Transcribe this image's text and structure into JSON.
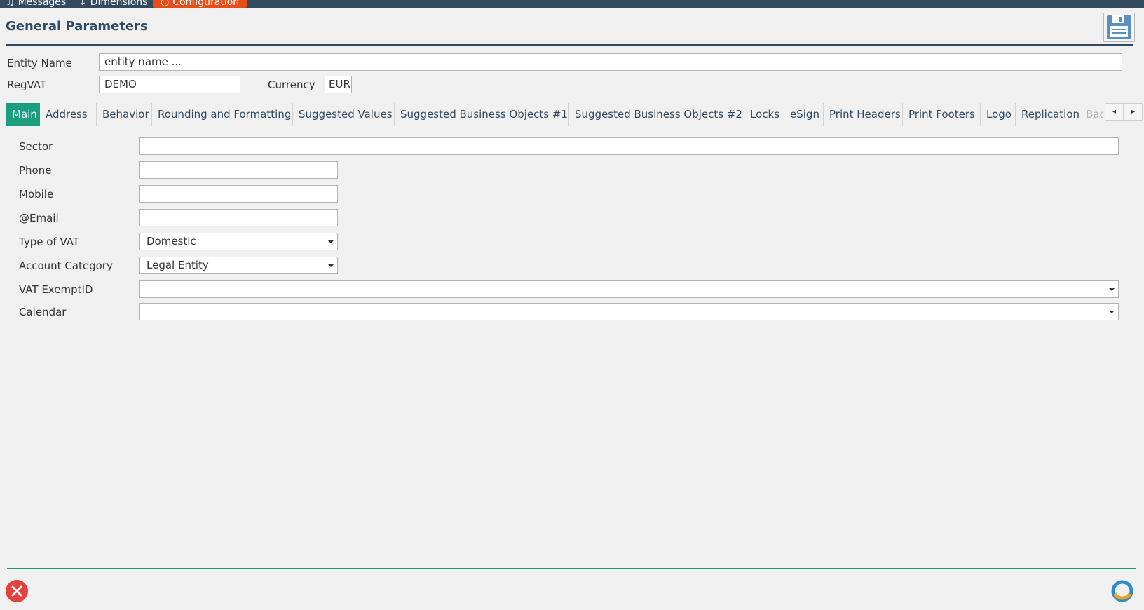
{
  "topbar": {
    "items": [
      {
        "icon": "music-note-icon",
        "glyph": "♫",
        "label": "Messages"
      },
      {
        "icon": "dimensions-icon",
        "glyph": "↕",
        "label": "Dimensions"
      },
      {
        "icon": "configuration-icon",
        "glyph": "○",
        "label": "Configuration"
      }
    ],
    "active": "Configuration",
    "bar_color": "#344a5e",
    "active_color": "#ea4b17"
  },
  "page": {
    "title": "General Parameters",
    "save_icon": "floppy-disk-icon"
  },
  "header_fields": {
    "entity_name": {
      "label": "Entity Name",
      "value": "entity name ..."
    },
    "regvat": {
      "label": "RegVAT",
      "value": "DEMO"
    },
    "currency": {
      "label": "Currency",
      "value": "EUR"
    }
  },
  "tabs": {
    "items": [
      "Main",
      "Address",
      "Behavior",
      "Rounding and Formatting",
      "Suggested Values",
      "Suggested Business Objects #1",
      "Suggested Business Objects #2",
      "Locks",
      "eSign",
      "Print Headers",
      "Print Footers",
      "Logo",
      "Replication",
      "Back"
    ],
    "active": "Main",
    "active_color": "#1b9e7d",
    "scroll_left_glyph": "◂",
    "scroll_right_glyph": "▸"
  },
  "main_form": {
    "sector": {
      "label": "Sector",
      "value": ""
    },
    "phone": {
      "label": "Phone",
      "value": ""
    },
    "mobile": {
      "label": "Mobile",
      "value": ""
    },
    "email": {
      "label": "@Email",
      "value": ""
    },
    "type_of_vat": {
      "label": "Type of VAT",
      "value": "Domestic"
    },
    "account_category": {
      "label": "Account Category",
      "value": "Legal Entity"
    },
    "vat_exemptid": {
      "label": "VAT ExemptID",
      "value": ""
    },
    "calendar": {
      "label": "Calendar",
      "value": ""
    }
  },
  "footer": {
    "close_icon": "close-icon",
    "close_color": "#e5413e",
    "logo_icon": "refresh-logo-icon"
  }
}
